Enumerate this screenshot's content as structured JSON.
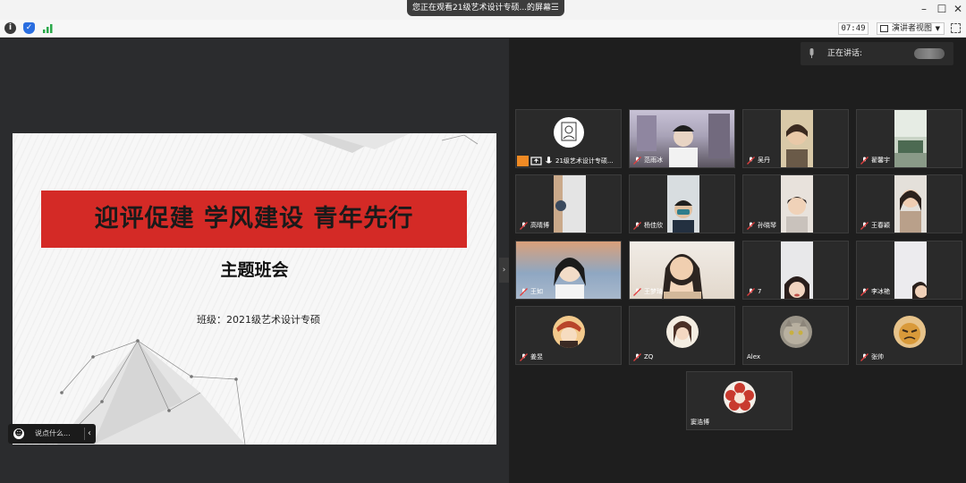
{
  "titlebar": {
    "share_text": "您正在观看21级艺术设计专硕...的屏幕",
    "menu_icon": "menu-icon",
    "window_controls": [
      "minimize-icon",
      "maximize-icon",
      "close-icon"
    ]
  },
  "toolbar": {
    "icons": [
      "info-icon",
      "shield-icon",
      "signal-icon"
    ],
    "time": "07:49",
    "view_mode": "演讲者视图",
    "fullscreen_icon": "fullscreen-icon"
  },
  "slide": {
    "banner": "迎评促建  学风建设  青年先行",
    "subtitle": "主题班会",
    "class_line": "班级：2021级艺术设计专硕",
    "banner_color": "#d42a26"
  },
  "chat": {
    "placeholder": "说点什么..."
  },
  "speaking": {
    "label": "正在讲话:"
  },
  "participants": [
    {
      "name": "21级艺术设计专硕...",
      "host": true
    },
    {
      "name": "范雨冰"
    },
    {
      "name": "吴丹"
    },
    {
      "name": "翟馨宇"
    },
    {
      "name": "高晴博"
    },
    {
      "name": "杨佳欣"
    },
    {
      "name": "孙晓琴"
    },
    {
      "name": "王春颖"
    },
    {
      "name": "王如"
    },
    {
      "name": "王梦琦"
    },
    {
      "name": "7"
    },
    {
      "name": "李冰艳"
    },
    {
      "name": "姜昱"
    },
    {
      "name": "ZQ"
    },
    {
      "name": "Alex"
    },
    {
      "name": "张帅"
    },
    {
      "name": "窦浩博"
    }
  ],
  "colors": {
    "mute_icon": "#e03e3e",
    "host_orange": "#f08a24",
    "info_icon": "#3a3a3a",
    "shield_icon": "#2a6ee0",
    "signal_icon": "#2aa84a"
  }
}
